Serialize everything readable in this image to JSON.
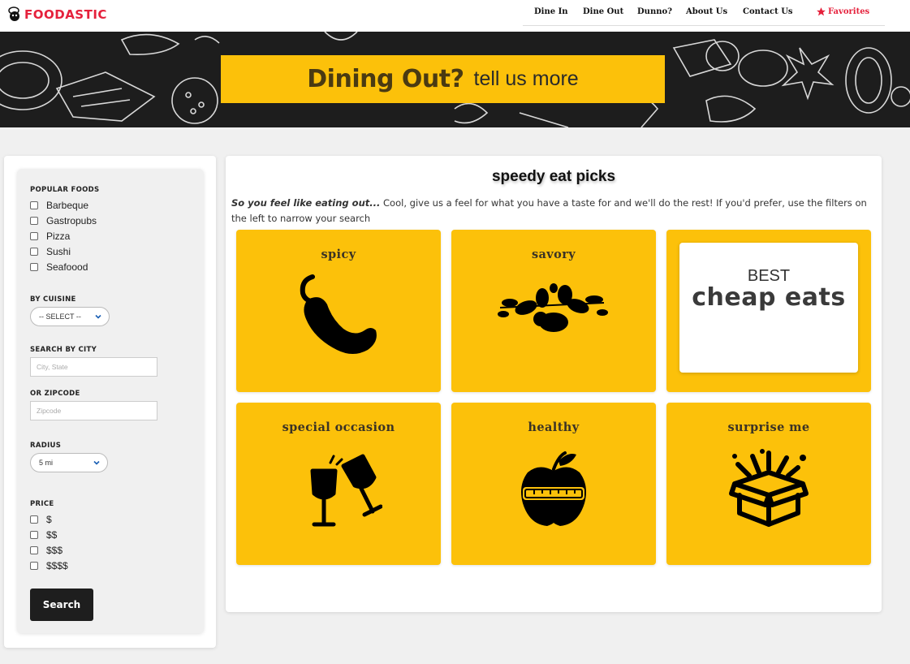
{
  "brand": {
    "name": "FOODASTIC",
    "logo_icon": "chef-mascot-icon",
    "accent": "#e5213c"
  },
  "nav": {
    "links": [
      "Dine In",
      "Dine Out",
      "Dunno?",
      "About Us",
      "Contact Us"
    ],
    "favorites": {
      "label": "Favorites",
      "icon": "star-icon"
    }
  },
  "hero": {
    "strong": "Dining Out?",
    "light": "tell us more",
    "box_color": "#fcc10a"
  },
  "filters": {
    "popular_foods": {
      "label": "POPULAR FOODS",
      "options": [
        "Barbeque",
        "Gastropubs",
        "Pizza",
        "Sushi",
        "Seafoood"
      ]
    },
    "cuisine": {
      "label": "BY CUISINE",
      "value": "-- SELECT --"
    },
    "city": {
      "label": "SEARCH BY CITY",
      "placeholder": "City, State"
    },
    "zipcode": {
      "label": "OR ZIPCODE",
      "placeholder": "Zipcode"
    },
    "radius": {
      "label": "RADIUS",
      "value": "5 mi"
    },
    "price": {
      "label": "PRICE",
      "options": [
        "$",
        "$$",
        "$$$",
        "$$$$"
      ]
    },
    "search_label": "Search"
  },
  "main": {
    "title": "speedy eat picks",
    "intro_bold": "So you feel like eating out...",
    "intro_text": " Cool, give us a feel for what you have a taste for and we'll do the rest! If you'd prefer, use the filters on the left to narrow your search",
    "tiles": [
      {
        "title": "spicy",
        "icon": "chili-pepper-icon"
      },
      {
        "title": "savory",
        "icon": "herbs-icon"
      },
      {
        "title": "",
        "icon": "",
        "card_top": "BEST",
        "card_bottom": "cheap eats"
      },
      {
        "title": "special occasion",
        "icon": "champagne-toast-icon"
      },
      {
        "title": "healthy",
        "icon": "apple-measuring-tape-icon"
      },
      {
        "title": "surprise me",
        "icon": "surprise-box-icon"
      }
    ]
  }
}
